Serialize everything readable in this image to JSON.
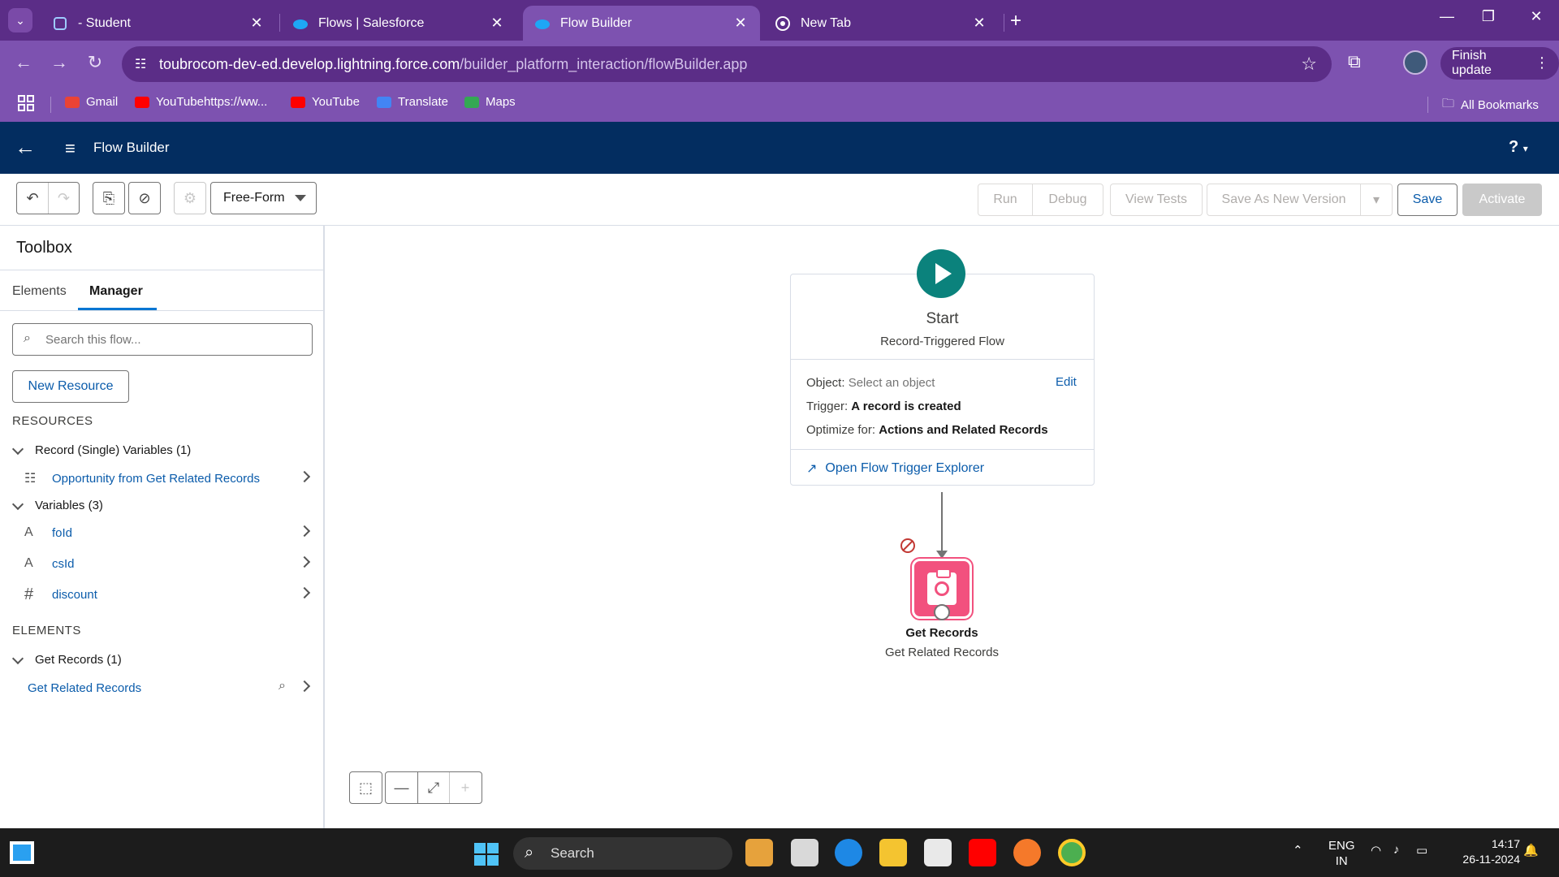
{
  "browser": {
    "tabs": [
      {
        "title": "- Student",
        "active": false
      },
      {
        "title": "Flows | Salesforce",
        "active": false
      },
      {
        "title": "Flow Builder",
        "active": true
      },
      {
        "title": "New Tab",
        "active": false
      }
    ],
    "url_host": "toubrocom-dev-ed.develop.lightning.force.com",
    "url_path": "/builder_platform_interaction/flowBuilder.app",
    "finish_update": "Finish update",
    "bookmarks": [
      "Gmail",
      "YouTubehttps://ww...",
      "YouTube",
      "Translate",
      "Maps"
    ],
    "all_bookmarks": "All Bookmarks"
  },
  "app": {
    "title": "Flow Builder",
    "help": "?"
  },
  "toolbar": {
    "layout_mode": "Free-Form",
    "run": "Run",
    "debug": "Debug",
    "view_tests": "View Tests",
    "save_as_new_version": "Save As New Version",
    "save": "Save",
    "activate": "Activate"
  },
  "toolbox": {
    "title": "Toolbox",
    "tabs": [
      "Elements",
      "Manager"
    ],
    "active_tab": "Manager",
    "search_placeholder": "Search this flow...",
    "new_resource": "New Resource",
    "resources_heading": "RESOURCES",
    "record_vars_group": "Record (Single) Variables (1)",
    "record_vars": [
      "Opportunity from Get Related Records"
    ],
    "variables_group": "Variables (3)",
    "variables": [
      {
        "name": "foId",
        "type_icon": "A"
      },
      {
        "name": "csId",
        "type_icon": "A"
      },
      {
        "name": "discount",
        "type_icon": "#"
      }
    ],
    "elements_heading": "ELEMENTS",
    "get_records_group": "Get Records (1)",
    "get_records_items": [
      "Get Related Records"
    ]
  },
  "canvas": {
    "start": {
      "title": "Start",
      "subtitle": "Record-Triggered Flow",
      "object_label": "Object:",
      "object_value": "Select an object",
      "edit": "Edit",
      "trigger_label": "Trigger:",
      "trigger_value": "A record is created",
      "optimize_label": "Optimize for:",
      "optimize_value": "Actions and Related Records",
      "explorer_link": "Open Flow Trigger Explorer"
    },
    "node": {
      "type": "Get Records",
      "label": "Get Related Records",
      "color": "#f2517e"
    }
  },
  "taskbar": {
    "search": "Search",
    "lang_top": "ENG",
    "lang_bottom": "IN",
    "time": "14:17",
    "date": "26-11-2024"
  },
  "colors": {
    "browser_frame": "#5b2d87",
    "sf_header": "#032d60",
    "start_icon": "#0b827c",
    "link": "#0b5cab"
  }
}
